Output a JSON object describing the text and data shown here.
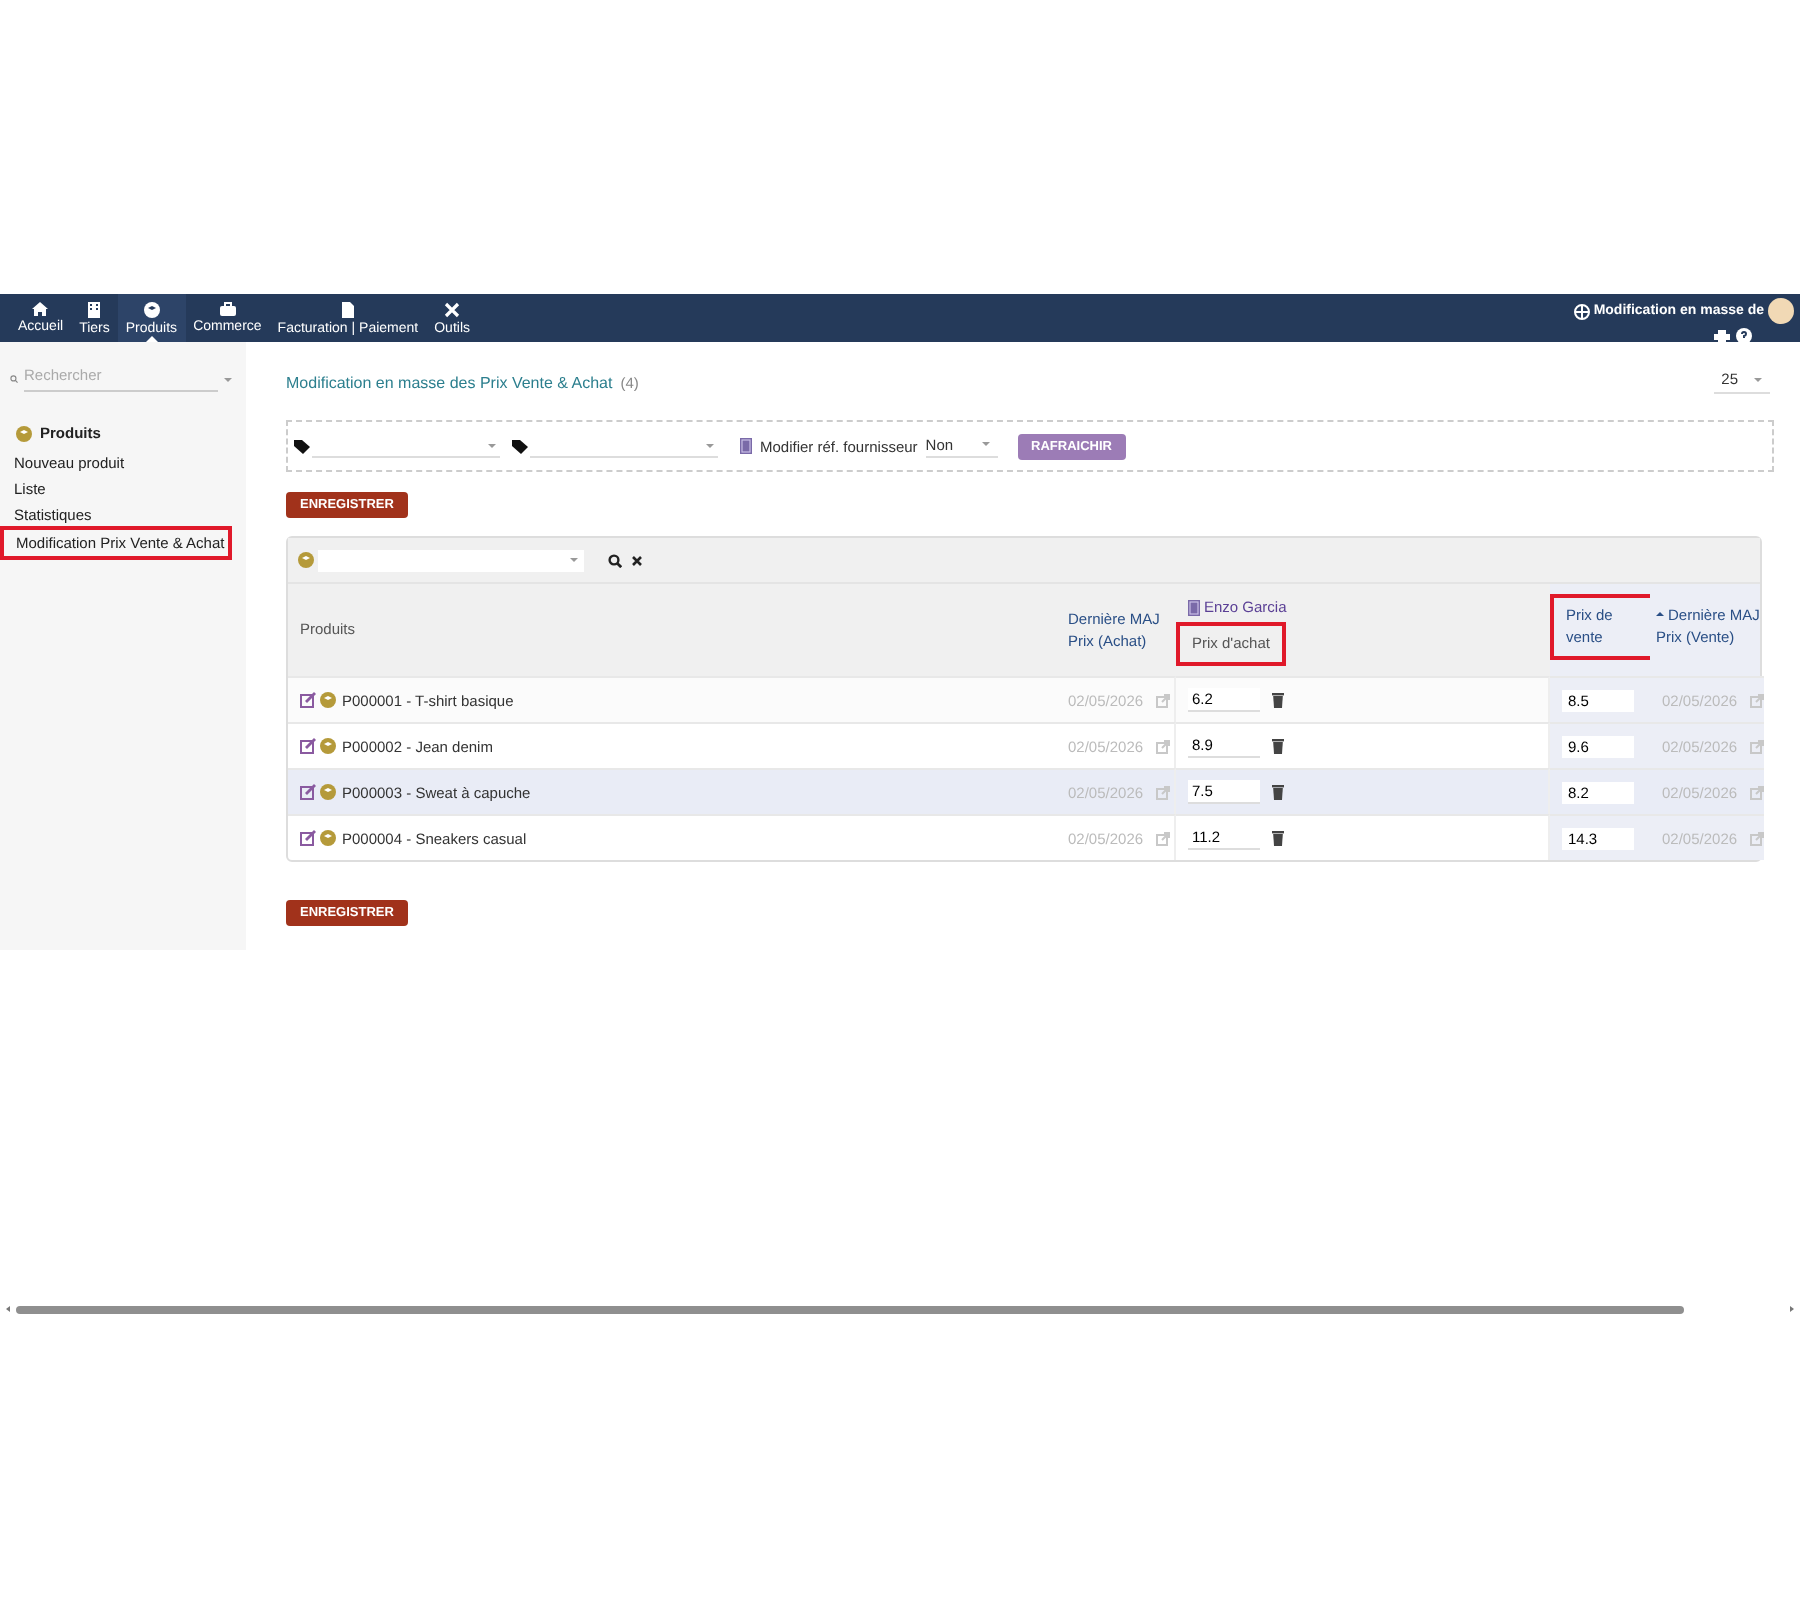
{
  "nav": {
    "items": [
      {
        "label": "Accueil",
        "selected": false
      },
      {
        "label": "Tiers",
        "selected": false
      },
      {
        "label": "Produits",
        "selected": true
      },
      {
        "label": "Commerce",
        "selected": false
      },
      {
        "label": "Facturation | Paiement",
        "selected": false
      },
      {
        "label": "Outils",
        "selected": false
      }
    ],
    "title": "Modification en masse de"
  },
  "sidebar": {
    "search": {
      "placeholder": "Rechercher"
    },
    "section": "Produits",
    "items": [
      {
        "label": "Nouveau produit",
        "highlighted": false
      },
      {
        "label": "Liste",
        "highlighted": false
      },
      {
        "label": "Statistiques",
        "highlighted": false
      },
      {
        "label": "Modification Prix Vente & Achat",
        "highlighted": true
      }
    ]
  },
  "page": {
    "title": "Modification en masse des Prix Vente & Achat",
    "count": "(4)",
    "page_size": "25"
  },
  "filters": {
    "supplier_ref_label": "Modifier réf. fournisseur",
    "supplier_ref_value": "Non",
    "refresh_button": "RAFRAICHIR"
  },
  "save_buttons": [
    "ENREGISTRER",
    "ENREGISTRER"
  ],
  "table": {
    "columns": [
      {
        "label": "Produits",
        "highlighted": false,
        "sorted": false
      },
      {
        "label": "Dernière MAJ Prix (Achat)",
        "highlighted": false,
        "sorted": false
      },
      {
        "supplier": "Enzo Garcia",
        "label": "Prix d'achat",
        "highlighted": true,
        "sorted": false
      },
      {
        "label": "Prix de vente",
        "highlighted": true,
        "sorted": false
      },
      {
        "label": "Dernière MAJ Prix (Vente)",
        "highlighted": false,
        "sorted": true
      }
    ],
    "rows": [
      {
        "product": "P000001 - T-shirt basique",
        "purchase_date": "02/05/2026",
        "purchase_price": "6.2",
        "sale_price": "8.5",
        "sale_date": "02/05/2026",
        "selected": false
      },
      {
        "product": "P000002 - Jean denim",
        "purchase_date": "02/05/2026",
        "purchase_price": "8.9",
        "sale_price": "9.6",
        "sale_date": "02/05/2026",
        "selected": false
      },
      {
        "product": "P000003 - Sweat à capuche",
        "purchase_date": "02/05/2026",
        "purchase_price": "7.5",
        "sale_price": "8.2",
        "sale_date": "02/05/2026",
        "selected": true
      },
      {
        "product": "P000004 - Sneakers casual",
        "purchase_date": "02/05/2026",
        "purchase_price": "11.2",
        "sale_price": "14.3",
        "sale_date": "02/05/2026",
        "selected": false
      }
    ]
  }
}
